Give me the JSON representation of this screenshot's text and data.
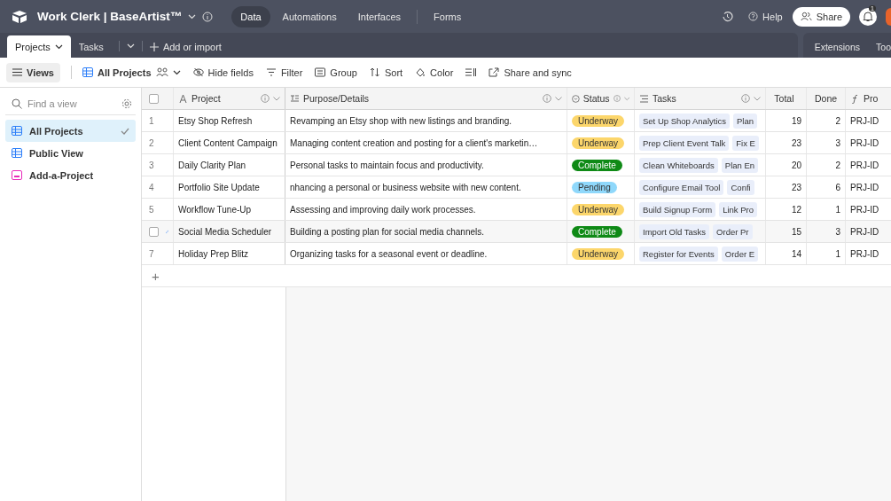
{
  "app": {
    "title": "Work Clerk | BaseArtist™",
    "nav": [
      {
        "label": "Data",
        "selected": true
      },
      {
        "label": "Automations",
        "selected": false
      },
      {
        "label": "Interfaces",
        "selected": false
      },
      {
        "label": "Forms",
        "selected": false
      }
    ],
    "help": "Help",
    "share": "Share",
    "notifications": "1"
  },
  "tables": [
    {
      "label": "Projects",
      "selected": true
    },
    {
      "label": "Tasks",
      "selected": false
    }
  ],
  "add_import": "Add or import",
  "extensions": "Extensions",
  "tools": "Too",
  "toolbar": {
    "views": "Views",
    "view_name": "All Projects",
    "actions": [
      {
        "kind": "hide",
        "label": "Hide fields"
      },
      {
        "kind": "filter",
        "label": "Filter"
      },
      {
        "kind": "group",
        "label": "Group"
      },
      {
        "kind": "sort",
        "label": "Sort"
      },
      {
        "kind": "color",
        "label": "Color"
      },
      {
        "kind": "height"
      },
      {
        "kind": "share",
        "label": "Share and sync"
      }
    ]
  },
  "sidebar": {
    "search": {
      "placeholder": "Find a view"
    },
    "items": [
      {
        "label": "All Projects",
        "kind": "grid",
        "selected": true
      },
      {
        "label": "Public View",
        "kind": "grid",
        "selected": false
      },
      {
        "label": "Add-a-Project",
        "kind": "form",
        "selected": false
      }
    ]
  },
  "table": {
    "select_all_checked": false,
    "columns": [
      {
        "label": "Project",
        "kind": "text"
      },
      {
        "label": "Purpose/Details",
        "kind": "longtext"
      },
      {
        "label": "Status",
        "kind": "select"
      },
      {
        "label": "Tasks",
        "kind": "link"
      },
      {
        "label": "Total",
        "kind": "rollup"
      },
      {
        "label": "Done",
        "kind": "rollup"
      },
      {
        "label": "Pro",
        "kind": "formula"
      }
    ],
    "rows": [
      {
        "num": "1",
        "hovered": false,
        "checked": false,
        "project": "Etsy Shop Refresh",
        "purpose": "Revamping an Etsy shop with new listings and branding.",
        "status": "Underway",
        "color": "#fcd66b",
        "tasks": [
          "Set Up Shop Analytics",
          "Plan"
        ],
        "total": "19",
        "done": "2",
        "pro": "PRJ-ID"
      },
      {
        "num": "2",
        "hovered": false,
        "checked": false,
        "project": "Client Content Campaign",
        "purpose": "Managing content creation and posting for a client's marketin…",
        "status": "Underway",
        "color": "#fcd66b",
        "tasks": [
          "Prep Client Event Talk",
          "Fix E"
        ],
        "total": "23",
        "done": "3",
        "pro": "PRJ-ID"
      },
      {
        "num": "3",
        "hovered": false,
        "checked": false,
        "project": "Daily Clarity Plan",
        "purpose": "Personal tasks to maintain focus and productivity.",
        "status": "Complete",
        "color": "#0f8a16",
        "tasks": [
          "Clean Whiteboards",
          "Plan En"
        ],
        "total": "20",
        "done": "2",
        "pro": "PRJ-ID"
      },
      {
        "num": "4",
        "hovered": false,
        "checked": false,
        "project": "Portfolio Site Update",
        "purpose": "nhancing a personal or business website with new content.",
        "status": "Pending",
        "color": "#8fd8fb",
        "tasks": [
          "Configure Email Tool",
          "Confi"
        ],
        "total": "23",
        "done": "6",
        "pro": "PRJ-ID"
      },
      {
        "num": "5",
        "hovered": false,
        "checked": false,
        "project": "Workflow Tune-Up",
        "purpose": "Assessing and improving daily work processes.",
        "status": "Underway",
        "color": "#fcd66b",
        "tasks": [
          "Build Signup Form",
          "Link Pro"
        ],
        "total": "12",
        "done": "1",
        "pro": "PRJ-ID"
      },
      {
        "hovered": true,
        "checked": false,
        "project": "Social Media Scheduler",
        "purpose": "Building a posting plan for social media channels.",
        "status": "Complete",
        "color": "#0f8a16",
        "tasks": [
          "Import Old Tasks",
          "Order Pr"
        ],
        "total": "15",
        "done": "3",
        "pro": "PRJ-ID"
      },
      {
        "num": "7",
        "hovered": false,
        "checked": false,
        "project": "Holiday Prep Blitz",
        "purpose": "Organizing tasks for a seasonal event or deadline.",
        "status": "Underway",
        "color": "#fcd66b",
        "tasks": [
          "Register for Events",
          "Order E"
        ],
        "total": "14",
        "done": "1",
        "pro": "PRJ-ID"
      }
    ],
    "add_row": "+"
  }
}
